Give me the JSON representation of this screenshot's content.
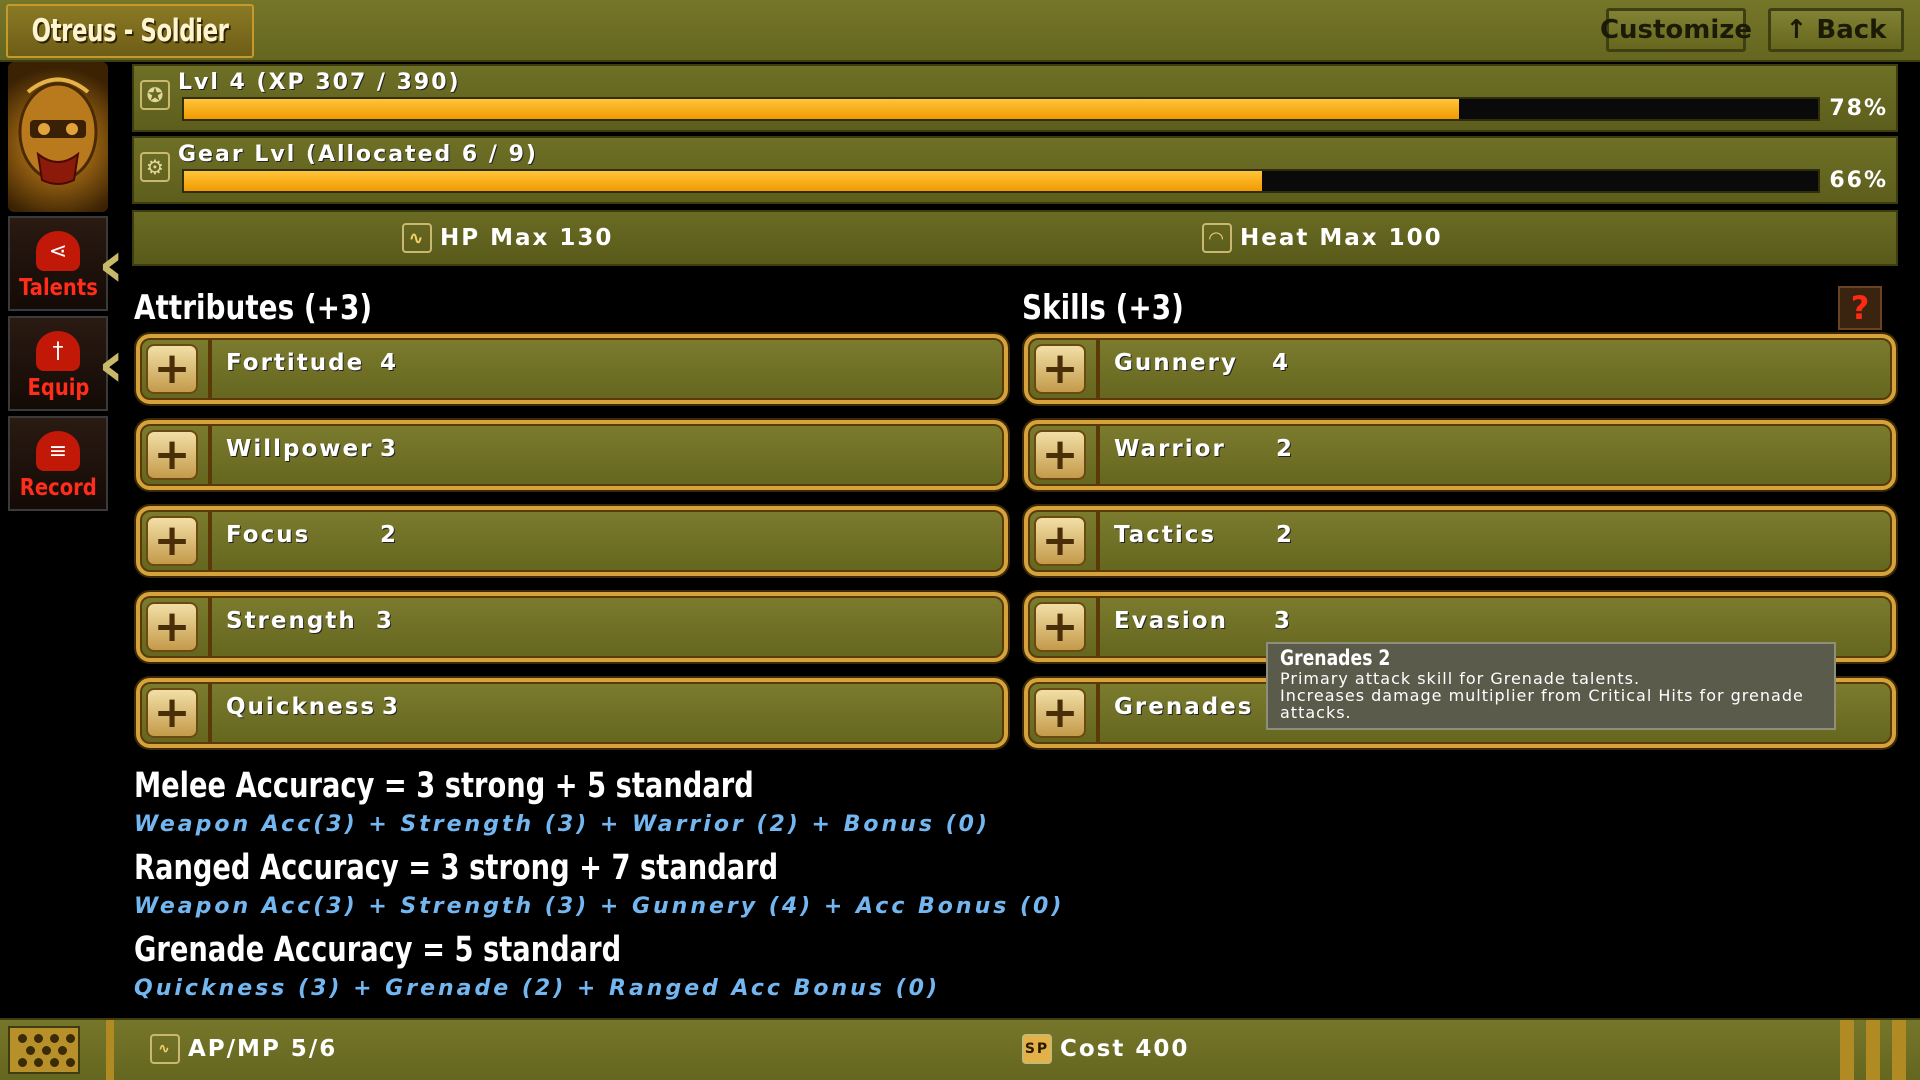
{
  "header": {
    "title": "Otreus - Soldier",
    "customize_label": "Customize",
    "back_label": "↑ Back"
  },
  "sidebar": {
    "items": [
      {
        "label": "Talents",
        "icon": "share-icon"
      },
      {
        "label": "Equip",
        "icon": "sword-icon"
      },
      {
        "label": "Record",
        "icon": "document-icon"
      }
    ]
  },
  "level": {
    "label": "Lvl 4 (XP 307 / 390)",
    "percent_text": "78%",
    "fill": 0.78
  },
  "gear": {
    "label": "Gear Lvl (Allocated 6 / 9)",
    "percent_text": "66%",
    "fill": 0.66
  },
  "stats": {
    "hp": "HP Max 130",
    "heat": "Heat Max 100"
  },
  "attributes": {
    "header": "Attributes (+3)",
    "rows": [
      {
        "name": "Fortitude",
        "value": "4"
      },
      {
        "name": "Willpower",
        "value": "3"
      },
      {
        "name": "Focus",
        "value": "2"
      },
      {
        "name": "Strength",
        "value": "3"
      },
      {
        "name": "Quickness",
        "value": "3"
      }
    ]
  },
  "skills": {
    "header": "Skills (+3)",
    "help": "?",
    "rows": [
      {
        "name": "Gunnery",
        "value": "4"
      },
      {
        "name": "Warrior",
        "value": "2"
      },
      {
        "name": "Tactics",
        "value": "2"
      },
      {
        "name": "Evasion",
        "value": "3"
      },
      {
        "name": "Grenades",
        "value": ""
      }
    ]
  },
  "tooltip": {
    "title": "Grenades   2",
    "line1": "Primary attack skill for Grenade talents.",
    "line2": "Increases damage multiplier from Critical Hits for grenade",
    "line3": "attacks."
  },
  "formulas": [
    {
      "title": "Melee Accuracy = 3 strong + 5 standard",
      "detail": "Weapon Acc(3) + Strength (3) + Warrior (2) + Bonus (0)"
    },
    {
      "title": "Ranged Accuracy = 3 strong + 7 standard",
      "detail": "Weapon Acc(3) + Strength (3) + Gunnery (4) + Acc Bonus (0)"
    },
    {
      "title": "Grenade Accuracy = 5 standard",
      "detail": "Quickness (3) + Grenade (2) + Ranged Acc Bonus (0)"
    }
  ],
  "footer": {
    "ap_mp": "AP/MP 5/6",
    "sp_icon": "SP",
    "cost": "Cost 400"
  },
  "colors": {
    "panel": "#6f7026",
    "bar_fill": "#f5a800",
    "row_border": "#d6a23c",
    "accent_red": "#ff2d1a",
    "formula_detail": "#74b6ef"
  }
}
